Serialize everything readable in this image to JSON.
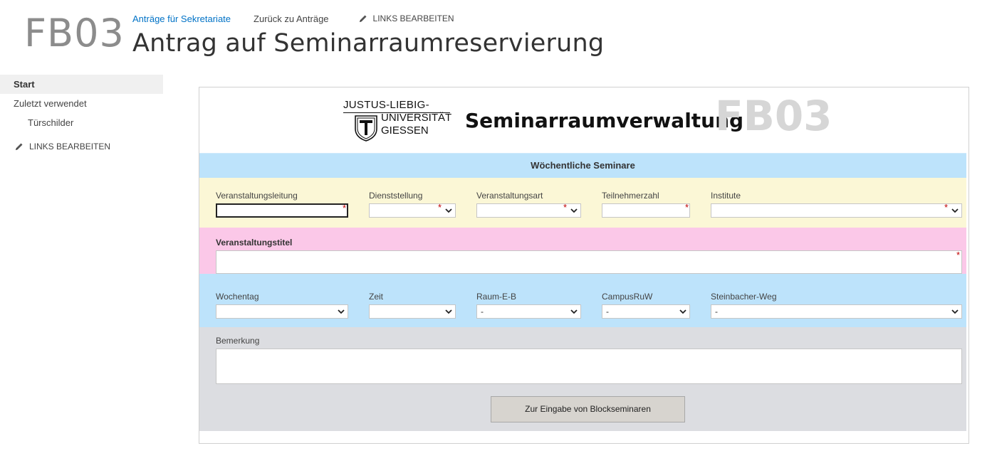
{
  "site": {
    "logo_text": "FB03",
    "page_title": "Antrag auf Seminarraumreservierung"
  },
  "top_nav": {
    "links": [
      "Anträge für Sekretariate",
      "Zurück zu Anträge"
    ],
    "edit_links_label": "LINKS BEARBEITEN"
  },
  "quick_launch": {
    "items": [
      "Start",
      "Zuletzt verwendet",
      "Türschilder"
    ],
    "edit_links_label": "LINKS BEARBEITEN"
  },
  "form": {
    "university_logo": {
      "line1": "JUSTUS-LIEBIG-",
      "line2": "UNIVERSITÄT",
      "line3": "GIESSEN"
    },
    "app_title": "Seminarraumverwaltung",
    "watermark": "FB03",
    "section_title": "Wöchentliche Seminare",
    "row1": {
      "veranstaltungsleitung": {
        "label": "Veranstaltungsleitung",
        "value": ""
      },
      "dienststellung": {
        "label": "Dienststellung",
        "value": ""
      },
      "veranstaltungsart": {
        "label": "Veranstaltungsart",
        "value": ""
      },
      "teilnehmerzahl": {
        "label": "Teilnehmerzahl",
        "value": ""
      },
      "institute": {
        "label": "Institute",
        "value": ""
      }
    },
    "veranstaltungstitel": {
      "label": "Veranstaltungstitel",
      "value": ""
    },
    "row3": {
      "wochentag": {
        "label": "Wochentag",
        "value": ""
      },
      "zeit": {
        "label": "Zeit",
        "value": ""
      },
      "raum_e_b": {
        "label": "Raum-E-B",
        "value": "-"
      },
      "campus_ruw": {
        "label": "CampusRuW",
        "value": "-"
      },
      "steinbacher_weg": {
        "label": "Steinbacher-Weg",
        "value": "-"
      }
    },
    "bemerkung": {
      "label": "Bemerkung",
      "value": ""
    },
    "required_marker": "*",
    "block_button_label": "Zur Eingabe von Blockseminaren"
  },
  "colors": {
    "link_active": "#0072c6",
    "band_blue": "#bde3fb",
    "band_yellow": "#fbf7d6",
    "band_pink": "#fbc8e8",
    "band_gray": "#dcdde1",
    "required": "#c00000"
  }
}
